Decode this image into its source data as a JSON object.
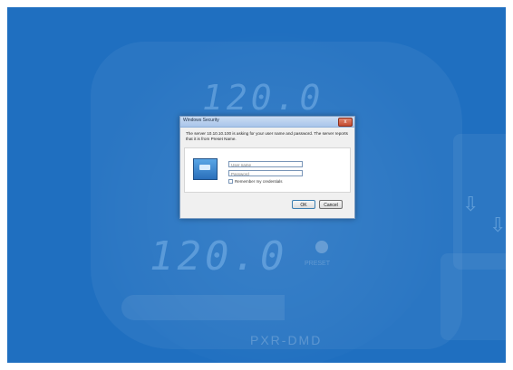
{
  "dialog": {
    "title": "Windows Security",
    "close_label": "x",
    "message": "The server 10.10.10.100 is asking for your user name and password. The server reports that it is from Preset Name.",
    "username_placeholder": "User name",
    "password_placeholder": "Password",
    "remember_label": "Remember my credentials",
    "ok_label": "OK",
    "cancel_label": "Cancel"
  },
  "background": {
    "display_top": "120.0",
    "display_bottom": "120.0",
    "brand_text": "PXR-DMD",
    "knob_label": "PRESET",
    "accent_color": "#1f6fc0"
  }
}
